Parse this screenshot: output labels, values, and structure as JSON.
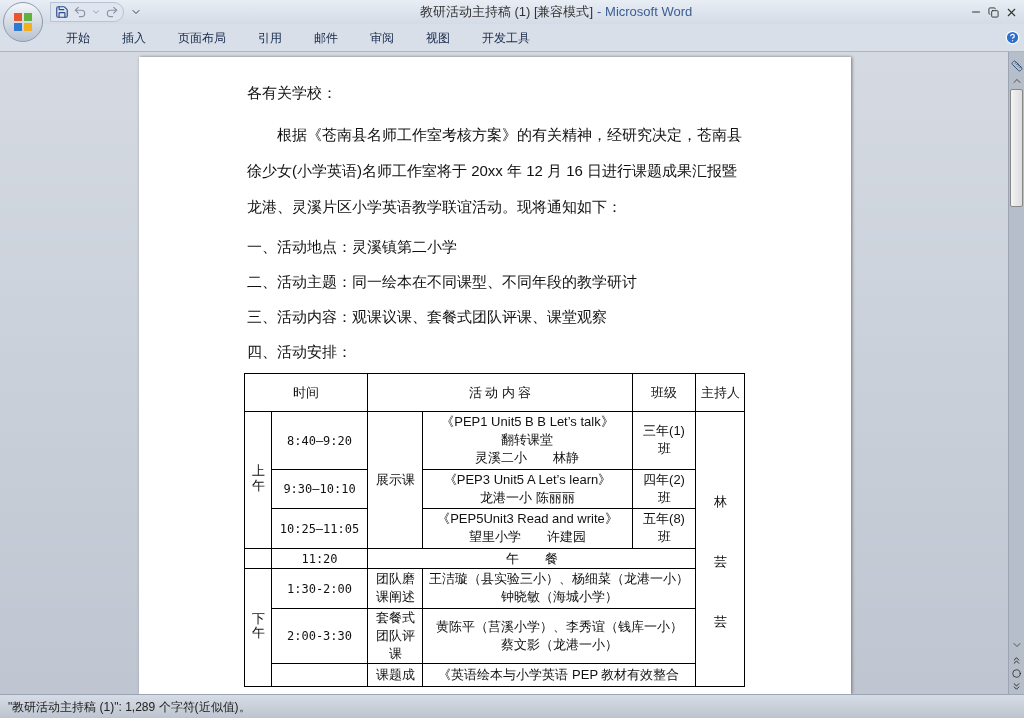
{
  "window": {
    "title": "教研活动主持稿 (1) [兼容模式]",
    "app": "- Microsoft Word"
  },
  "ribbon_tabs": [
    {
      "label": "开始",
      "selected": false
    },
    {
      "label": "插入",
      "selected": false
    },
    {
      "label": "页面布局",
      "selected": false
    },
    {
      "label": "引用",
      "selected": false
    },
    {
      "label": "邮件",
      "selected": false
    },
    {
      "label": "审阅",
      "selected": false
    },
    {
      "label": "视图",
      "selected": false
    },
    {
      "label": "开发工具",
      "selected": false
    }
  ],
  "document": {
    "greeting": "各有关学校：",
    "body": "根据《苍南县名师工作室考核方案》的有关精神，经研究决定，苍南县徐少女(小学英语)名师工作室将于 20xx 年 12 月 16 日进行课题成果汇报暨龙港、灵溪片区小学英语教学联谊活动。现将通知如下：",
    "items": [
      "一、活动地点：灵溪镇第二小学",
      "二、活动主题：同一绘本在不同课型、不同年段的教学研讨",
      "三、活动内容：观课议课、套餐式团队评课、课堂观察",
      "四、活动安排："
    ],
    "table": {
      "headers": {
        "time": "时间",
        "content": "活 动 内 容",
        "class": "班级",
        "host": "主持人"
      },
      "host_lines": [
        "林",
        "芸",
        "芸"
      ],
      "morning": {
        "period": "上午",
        "type": "展示课",
        "slots": [
          {
            "time": "8:40—9:20",
            "content": [
              "《PEP1 Unit5 B B Let’s talk》",
              "翻转课堂",
              "灵溪二小　　林静"
            ],
            "class": "三年(1)班"
          },
          {
            "time": "9:30—10:10",
            "content": [
              "《PEP3 Unit5 A Let’s learn》",
              "龙港一小 陈丽丽"
            ],
            "class": "四年(2)班"
          },
          {
            "time": "10:25—11:05",
            "content": [
              "《PEP5Unit3 Read and write》",
              "望里小学　　许建园"
            ],
            "class": "五年(8)班"
          }
        ]
      },
      "lunch": {
        "time": "11:20",
        "label": "午　　餐"
      },
      "afternoon": {
        "period": "下午",
        "slots": [
          {
            "time": "1:30-2:00",
            "type": "团队磨课阐述",
            "content": [
              "王洁璇（县实验三小）、杨细菜（龙港一小）",
              "钟晓敏（海城小学）"
            ]
          },
          {
            "time": "2:00-3:30",
            "type": "套餐式团队评课",
            "content": [
              "黄陈平（莒溪小学）、李秀谊（钱库一小）",
              "蔡文影（龙港一小）"
            ]
          },
          {
            "type": "课题成",
            "content": [
              "《英语绘本与小学英语 PEP 教材有效整合"
            ]
          }
        ]
      }
    }
  },
  "status_bar": "\"教研活动主持稿 (1)\": 1,289 个字符(近似值)。"
}
